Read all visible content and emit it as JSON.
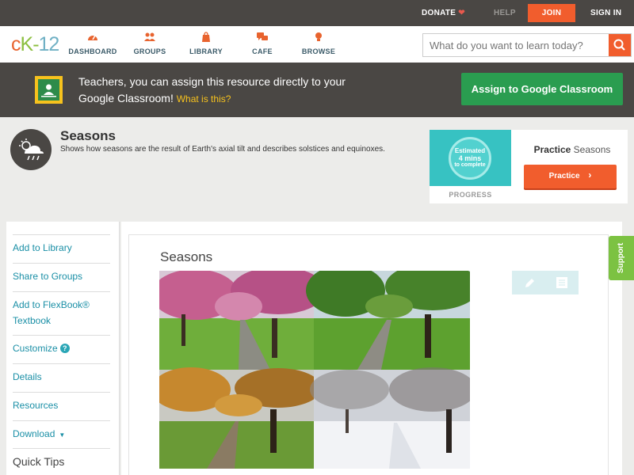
{
  "topbar": {
    "donate": "DONATE",
    "help": "HELP",
    "join": "JOIN",
    "signin": "SIGN IN"
  },
  "nav": {
    "logo": {
      "c": "c",
      "k": "K",
      "dash": "-",
      "n": "12"
    },
    "items": [
      {
        "label": "DASHBOARD",
        "icon": "dashboard-gauge-icon"
      },
      {
        "label": "GROUPS",
        "icon": "groups-people-icon"
      },
      {
        "label": "LIBRARY",
        "icon": "library-bag-icon"
      },
      {
        "label": "CAFE",
        "icon": "cafe-chat-icon"
      },
      {
        "label": "BROWSE",
        "icon": "browse-lightbulb-icon"
      }
    ],
    "search_placeholder": "What do you want to learn today?"
  },
  "banner": {
    "text": "Teachers, you can assign this resource directly to your Google Classroom!",
    "what": "What is this?",
    "button": "Assign to Google Classroom"
  },
  "concept": {
    "title": "Seasons",
    "description": "Shows how seasons are the result of Earth's axial tilt and describes solstices and equinoxes."
  },
  "progress": {
    "estimated": "Estimated",
    "mins": "4 mins",
    "to_complete": "to complete",
    "label": "PROGRESS",
    "practice_bold": "Practice",
    "practice_topic": "Seasons",
    "practice_button": "Practice"
  },
  "sidebar": {
    "items": [
      {
        "label": "Add to Library"
      },
      {
        "label": "Share to Groups"
      },
      {
        "label": "Add to FlexBook® Textbook"
      },
      {
        "label": "Customize"
      },
      {
        "label": "Details"
      },
      {
        "label": "Resources"
      },
      {
        "label": "Download"
      }
    ],
    "help_glyph": "?",
    "caret": "▼",
    "quick_tips": "Quick Tips"
  },
  "content": {
    "title": "Seasons"
  },
  "support": "Support",
  "colors": {
    "accent_orange": "#f15d2d",
    "dark_bar": "#4a4744",
    "google_green": "#2a9d50",
    "link_teal": "#1a8fa6",
    "support_green": "#7cc242"
  }
}
